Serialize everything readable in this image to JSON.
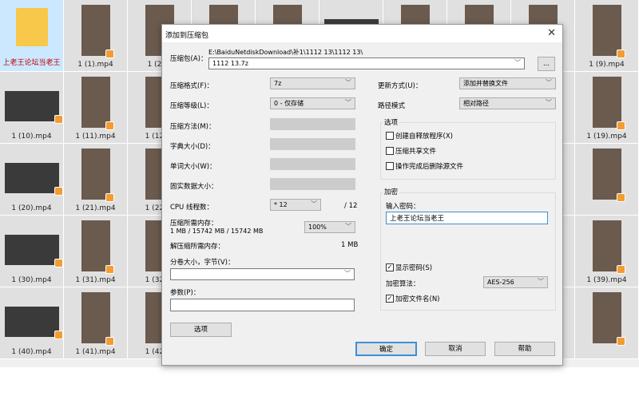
{
  "files": [
    {
      "name": "上老王论坛当老王",
      "type": "folder",
      "selected": true
    },
    {
      "name": "1 (1).mp4"
    },
    {
      "name": "1 (2)..."
    },
    {
      "name": ""
    },
    {
      "name": ""
    },
    {
      "name": ""
    },
    {
      "name": ""
    },
    {
      "name": ""
    },
    {
      "name": ""
    },
    {
      "name": "1 (9).mp4"
    },
    {
      "name": "1 (10).mp4"
    },
    {
      "name": "1 (11).mp4"
    },
    {
      "name": "1 (12)..."
    },
    {
      "name": ""
    },
    {
      "name": ""
    },
    {
      "name": ""
    },
    {
      "name": ""
    },
    {
      "name": ""
    },
    {
      "name": ""
    },
    {
      "name": "1 (19).mp4"
    },
    {
      "name": "1 (20).mp4"
    },
    {
      "name": "1 (21).mp4"
    },
    {
      "name": "1 (22)..."
    },
    {
      "name": ""
    },
    {
      "name": ""
    },
    {
      "name": ""
    },
    {
      "name": ""
    },
    {
      "name": ""
    },
    {
      "name": ""
    },
    {
      "name": ""
    },
    {
      "name": "1 (30).mp4"
    },
    {
      "name": "1 (31).mp4"
    },
    {
      "name": "1 (32)..."
    },
    {
      "name": ""
    },
    {
      "name": ""
    },
    {
      "name": ""
    },
    {
      "name": ""
    },
    {
      "name": ""
    },
    {
      "name": ""
    },
    {
      "name": "1 (39).mp4"
    },
    {
      "name": "1 (40).mp4"
    },
    {
      "name": "1 (41).mp4"
    },
    {
      "name": "1 (42)..."
    },
    {
      "name": ""
    },
    {
      "name": ""
    },
    {
      "name": ""
    },
    {
      "name": ""
    },
    {
      "name": ""
    },
    {
      "name": ""
    },
    {
      "name": ""
    }
  ],
  "dialog": {
    "title": "添加到压缩包",
    "archive_label": "压缩包(A)：",
    "archive_path": "E:\\BaiduNetdiskDownload\\补1\\1112 13\\1112 13\\",
    "archive_name": "1112 13.7z",
    "browse": "...",
    "format_label": "压缩格式(F)：",
    "format": "7z",
    "level_label": "压缩等级(L)：",
    "level": "0 - 仅存储",
    "method_label": "压缩方法(M)：",
    "dict_label": "字典大小(D)：",
    "word_label": "单词大小(W)：",
    "solid_label": "固实数据大小：",
    "cpu_label": "CPU 线程数：",
    "cpu": "* 12",
    "cpu_max": "/ 12",
    "mem_label": "压缩所需内存：",
    "mem_value": "1 MB / 15742 MB / 15742 MB",
    "mem_pct": "100%",
    "dmem_label": "解压缩所需内存：",
    "dmem_value": "1 MB",
    "split_label": "分卷大小，字节(V)：",
    "split": "",
    "params_label": "参数(P)：",
    "params": "",
    "options_btn": "选项",
    "update_label": "更新方式(U)：",
    "update": "添加并替换文件",
    "path_label": "路径模式",
    "path": "相对路径",
    "options_group": "选项",
    "opt_sfx": "创建自释放程序(X)",
    "opt_shared": "压缩共享文件",
    "opt_delete": "操作完成后删除源文件",
    "enc_group": "加密",
    "pwd_label": "输入密码：",
    "pwd": "上老王论坛当老王",
    "show_pwd": "显示密码(S)",
    "enc_method_label": "加密算法：",
    "enc_method": "AES-256",
    "enc_names": "加密文件名(N)",
    "ok": "确定",
    "cancel": "取消",
    "help": "帮助"
  }
}
